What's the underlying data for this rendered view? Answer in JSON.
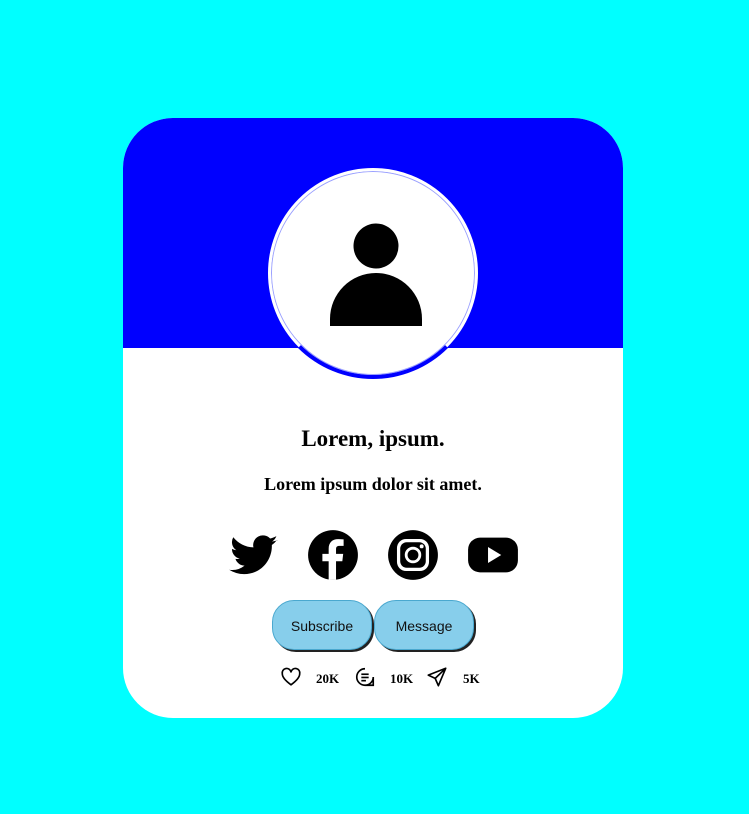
{
  "profile": {
    "name": "Lorem, ipsum.",
    "tagline": "Lorem ipsum dolor sit amet.",
    "avatar_icon": "user-icon"
  },
  "social": [
    {
      "icon": "twitter-icon"
    },
    {
      "icon": "facebook-icon"
    },
    {
      "icon": "instagram-icon"
    },
    {
      "icon": "youtube-icon"
    }
  ],
  "actions": {
    "subscribe_label": "Subscribe",
    "message_label": "Message"
  },
  "stats": {
    "likes": "20K",
    "comments": "10K",
    "shares": "5K"
  },
  "colors": {
    "background": "#00ffff",
    "header": "#0000ff",
    "button": "#87ceeb",
    "card": "#ffffff"
  }
}
